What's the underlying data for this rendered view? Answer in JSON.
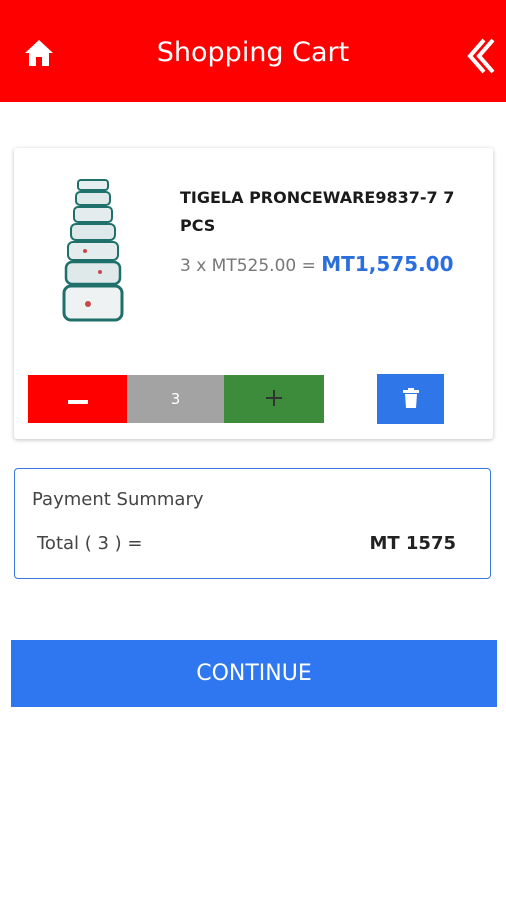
{
  "header": {
    "title": "Shopping Cart",
    "home_icon": "home-icon",
    "back_icon": "double-chevron-left-icon",
    "background": "#ff0000"
  },
  "cart": {
    "items": [
      {
        "name": "TIGELA PRONCEWARE9837-7 7 PCS",
        "unit_price_text": "3 x MT525.00 = ",
        "line_total": "MT1,575.00",
        "quantity": "3",
        "image_icon": "stacked-bowls-product-image"
      }
    ]
  },
  "controls": {
    "minus_icon": "minus-icon",
    "plus_icon": "plus-icon",
    "delete_icon": "trash-icon",
    "minus_color": "#ff0000",
    "plus_color": "#3c8c3c",
    "delete_color": "#2f77e8"
  },
  "summary": {
    "title": "Payment Summary",
    "total_label": "Total ( 3 ) =",
    "total_value": "MT 1575"
  },
  "actions": {
    "continue_label": "CONTINUE",
    "accent": "#2f77f0"
  }
}
